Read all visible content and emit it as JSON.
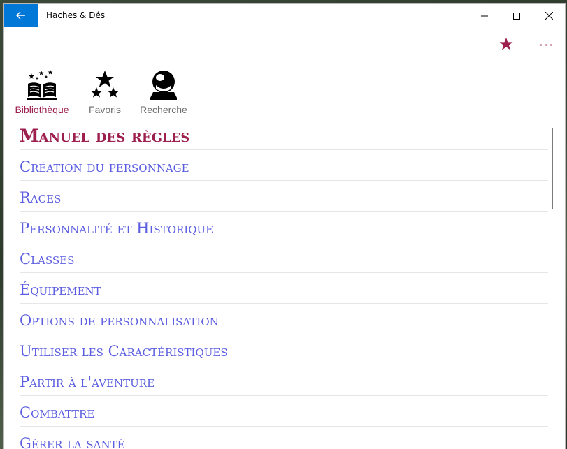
{
  "window": {
    "title": "Haches & Dés"
  },
  "titlebar": {
    "back_icon": "arrow-left-icon",
    "minimize_icon": "minimize-icon",
    "maximize_icon": "maximize-icon",
    "close_icon": "close-icon",
    "accent_color": "#0078d7"
  },
  "toolbar": {
    "favorite_icon": "star-icon",
    "more_icon": "more-icon",
    "more_label": "···",
    "accent_color": "#9c1f4e"
  },
  "nav": {
    "items": [
      {
        "label": "Bibliothèque",
        "icon": "open-book-icon",
        "active": true
      },
      {
        "label": "Favoris",
        "icon": "stars-icon",
        "active": false
      },
      {
        "label": "Recherche",
        "icon": "crystal-ball-icon",
        "active": false
      }
    ]
  },
  "content": {
    "title": "Manuel des règles",
    "chapters": [
      "Création du personnage",
      "Races",
      "Personnalité et Historique",
      "Classes",
      "Équipement",
      "Options de personnalisation",
      "Utiliser les Caractéristiques",
      "Partir à l'aventure",
      "Combattre",
      "Gérer la santé"
    ],
    "title_color": "#9c1f4e",
    "link_color": "#5b5ee0"
  }
}
